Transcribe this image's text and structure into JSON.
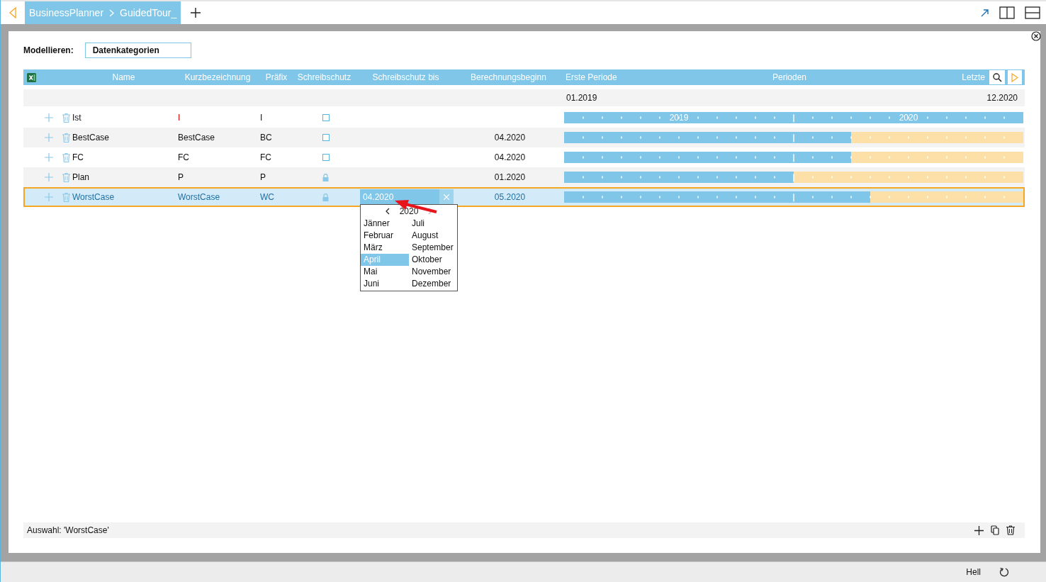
{
  "tab_bar": {
    "breadcrumb": [
      "BusinessPlanner",
      "GuidedTour_"
    ]
  },
  "model": {
    "label": "Modellieren:",
    "value": "Datenkategorien"
  },
  "table": {
    "columns": [
      "Name",
      "Kurzbezeichnung",
      "Präfix",
      "Schreibschutz",
      "Schreibschutz bis",
      "Berechnungsbeginn"
    ],
    "period_header": {
      "first": "Erste Periode",
      "middle": "Perioden",
      "last": "Letzte"
    },
    "period_range": {
      "start": "01.2019",
      "end": "12.2020"
    },
    "rows": [
      {
        "name": "Ist",
        "short": "I",
        "prefix": "I",
        "write_protected": false,
        "calc_start": "",
        "level": 1,
        "year_labels": [
          "2019",
          "2020"
        ],
        "selected": false,
        "editing": false
      },
      {
        "name": "BestCase",
        "short": "BestCase",
        "prefix": "BC",
        "write_protected": false,
        "calc_start": "04.2020",
        "level": 0.625,
        "selected": false,
        "editing": false
      },
      {
        "name": "FC",
        "short": "FC",
        "prefix": "FC",
        "write_protected": false,
        "calc_start": "04.2020",
        "level": 0.625,
        "selected": false,
        "editing": false
      },
      {
        "name": "Plan",
        "short": "P",
        "prefix": "P",
        "write_protected": true,
        "calc_start": "01.2020",
        "level": 0.5,
        "selected": false,
        "editing": false
      },
      {
        "name": "WorstCase",
        "short": "WorstCase",
        "prefix": "WC",
        "write_protected": true,
        "protected_until": "04.2020",
        "calc_start": "05.2020",
        "level": 0.6667,
        "selected": true,
        "editing": true
      }
    ]
  },
  "month_picker": {
    "year": "2020",
    "months": [
      {
        "label": "Jänner",
        "selected": false
      },
      {
        "label": "Februar",
        "selected": false
      },
      {
        "label": "März",
        "selected": false
      },
      {
        "label": "April",
        "selected": true
      },
      {
        "label": "Mai",
        "selected": false
      },
      {
        "label": "Juni",
        "selected": false
      },
      {
        "label": "Juli",
        "selected": false
      },
      {
        "label": "August",
        "selected": false
      },
      {
        "label": "September",
        "selected": false
      },
      {
        "label": "Oktober",
        "selected": false
      },
      {
        "label": "November",
        "selected": false
      },
      {
        "label": "Dezember",
        "selected": false
      }
    ]
  },
  "footer": {
    "selection": "Auswahl: 'WorstCase'"
  },
  "status_bar": {
    "theme": "Hell"
  }
}
